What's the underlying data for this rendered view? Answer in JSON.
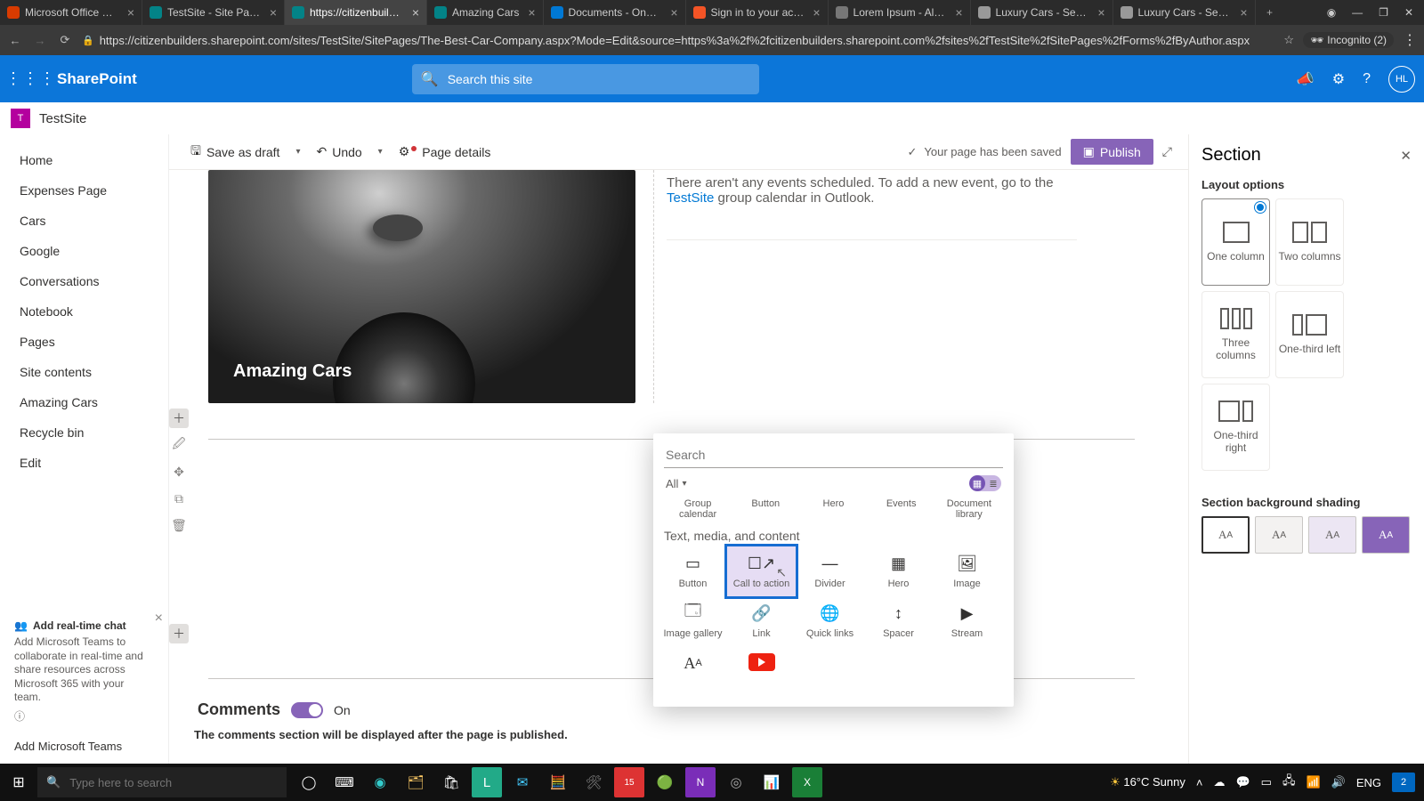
{
  "browser": {
    "tabs": [
      {
        "title": "Microsoft Office Home",
        "fav": "#d83b01"
      },
      {
        "title": "TestSite - Site Pages -",
        "fav": "#038387"
      },
      {
        "title": "https://citizenbuilders",
        "fav": "#038387",
        "active": true
      },
      {
        "title": "Amazing Cars",
        "fav": "#038387"
      },
      {
        "title": "Documents - OneDriv",
        "fav": "#0078d4"
      },
      {
        "title": "Sign in to your accoun",
        "fav": "#f35426"
      },
      {
        "title": "Lorem Ipsum - All the",
        "fav": "#777"
      },
      {
        "title": "Luxury Cars - Sedans,",
        "fav": "#999"
      },
      {
        "title": "Luxury Cars - Sedans,",
        "fav": "#999"
      }
    ],
    "url": "https://citizenbuilders.sharepoint.com/sites/TestSite/SitePages/The-Best-Car-Company.aspx?Mode=Edit&source=https%3a%2f%2fcitizenbuilders.sharepoint.com%2fsites%2fTestSite%2fSitePages%2fForms%2fByAuthor.aspx",
    "incognito_label": "Incognito (2)"
  },
  "suitebar": {
    "brand": "SharePoint",
    "search_placeholder": "Search this site",
    "avatar_initials": "HL"
  },
  "site": {
    "logo_initial": "T",
    "name": "TestSite"
  },
  "leftnav": {
    "items": [
      "Home",
      "Expenses Page",
      "Cars",
      "Google",
      "Conversations",
      "Notebook",
      "Pages",
      "Site contents",
      "Amazing Cars",
      "Recycle bin",
      "Edit"
    ],
    "teams_promo_title": "Add real-time chat",
    "teams_promo_body": "Add Microsoft Teams to collaborate in real-time and share resources across Microsoft 365 with your team.",
    "teams_action": "Add Microsoft Teams"
  },
  "cmdbar": {
    "save_as_draft": "Save as draft",
    "undo": "Undo",
    "page_details": "Page details",
    "status": "Your page has been saved",
    "publish": "Publish"
  },
  "canvas": {
    "hero_title": "Amazing Cars",
    "events_text_1": "There aren't any events scheduled. To add a new event, go to the ",
    "events_link": "TestSite",
    "events_text_2": " group calendar in Outlook.",
    "comments_label": "Comments",
    "comments_state": "On",
    "comments_note": "The comments section will be displayed after the page is published."
  },
  "picker": {
    "search_placeholder": "Search",
    "filter_all": "All",
    "partial_row": [
      "Group calendar",
      "Button",
      "Hero",
      "Events",
      "Document library"
    ],
    "section_title": "Text, media, and content",
    "row1": [
      "Button",
      "Call to action",
      "Divider",
      "Hero",
      "Image"
    ],
    "row2": [
      "Image gallery",
      "Link",
      "Quick links",
      "Spacer",
      "Stream"
    ]
  },
  "proppane": {
    "title": "Section",
    "layout_label": "Layout options",
    "options": [
      "One column",
      "Two columns",
      "Three columns",
      "One-third left",
      "One-third right"
    ],
    "shading_label": "Section background shading"
  },
  "taskbar": {
    "search_placeholder": "Type here to search",
    "weather": "16°C  Sunny",
    "lang": "ENG",
    "notif": "2"
  }
}
